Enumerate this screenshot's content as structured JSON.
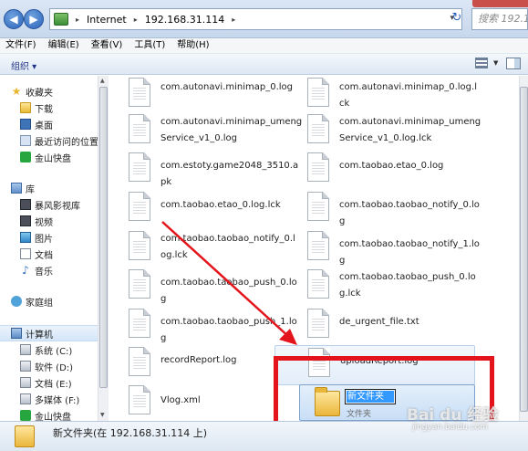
{
  "address_bar": {
    "crumbs": [
      "Internet",
      "192.168.31.114"
    ],
    "search_placeholder": "搜索 192.1..."
  },
  "menu": [
    "文件(F)",
    "编辑(E)",
    "查看(V)",
    "工具(T)",
    "帮助(H)"
  ],
  "toolbar": {
    "organize_label": "组织 ▾"
  },
  "nav": {
    "favorites": {
      "label": "收藏夹",
      "items": [
        "下载",
        "桌面",
        "最近访问的位置",
        "金山快盘"
      ]
    },
    "libraries": {
      "label": "库",
      "items": [
        "暴风影视库",
        "视频",
        "图片",
        "文档",
        "音乐"
      ]
    },
    "homegroup": {
      "label": "家庭组"
    },
    "computer": {
      "label": "计算机",
      "items": [
        "系统 (C:)",
        "软件 (D:)",
        "文档 (E:)",
        "多媒体 (F:)",
        "金山快盘"
      ]
    }
  },
  "files": [
    "com.autonavi.minimap_0.log",
    "com.autonavi.minimap_0.log.lck",
    "com.autonavi.minimap_umengService_v1_0.log",
    "com.autonavi.minimap_umengService_v1_0.log.lck",
    "com.estoty.game2048_3510.apk",
    "com.taobao.etao_0.log",
    "com.taobao.etao_0.log.lck",
    "com.taobao.taobao_notify_0.log",
    "com.taobao.taobao_notify_0.log.lck",
    "com.taobao.taobao_notify_1.log",
    "com.taobao.taobao_push_0.log",
    "com.taobao.taobao_push_0.log.lck",
    "com.taobao.taobao_push_1.log",
    "de_urgent_file.txt",
    "recordReport.log",
    "uploadReport.log",
    "Vlog.xml"
  ],
  "new_folder": {
    "name": "新文件夹",
    "type": "文件夹"
  },
  "details": {
    "text": "新文件夹(在 192.168.31.114 上)"
  },
  "watermark": {
    "main": "Bai du 经验",
    "sub": "jingyan.baidu.com"
  },
  "colors": {
    "annotation": "#e4141c",
    "selection": "#3399ff"
  }
}
